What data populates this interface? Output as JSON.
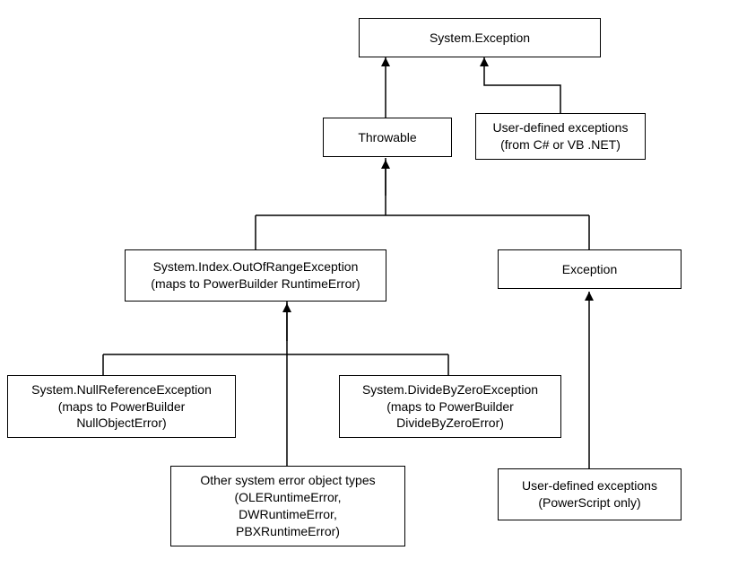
{
  "nodes": {
    "root": {
      "line1": "System.Exception"
    },
    "throwable": {
      "line1": "Throwable"
    },
    "userCS": {
      "line1": "User-defined exceptions",
      "line2": "(from C# or VB .NET)"
    },
    "sysIndex": {
      "line1": "System.Index.OutOfRangeException",
      "line2": "(maps to PowerBuilder RuntimeError)"
    },
    "exception": {
      "line1": "Exception"
    },
    "nullRef": {
      "line1": "System.NullReferenceException",
      "line2": "(maps to PowerBuilder",
      "line3": "NullObjectError)"
    },
    "divZero": {
      "line1": "System.DivideByZeroException",
      "line2": "(maps to PowerBuilder",
      "line3": "DivideByZeroError)"
    },
    "otherSys": {
      "line1": "Other system error object types",
      "line2": "(OLERuntimeError,",
      "line3": "DWRuntimeError,",
      "line4": "PBXRuntimeError)"
    },
    "userPS": {
      "line1": "User-defined exceptions",
      "line2": "(PowerScript only)"
    }
  }
}
